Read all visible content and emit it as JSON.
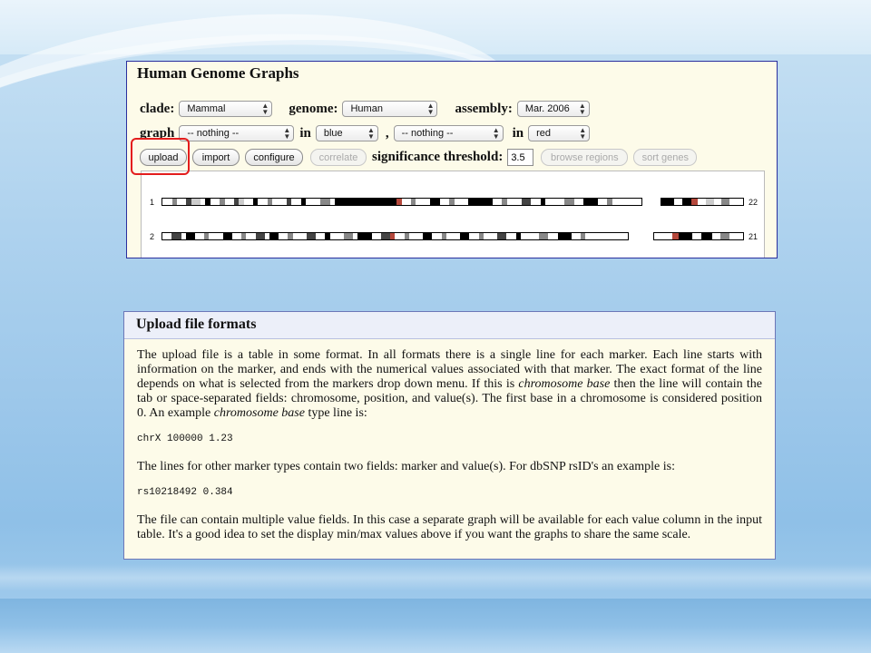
{
  "panel1": {
    "title": "Human Genome Graphs",
    "labels": {
      "clade": "clade:",
      "genome": "genome:",
      "assembly": "assembly:",
      "graph": "graph",
      "in1": "in",
      "comma": ",",
      "in2": "in",
      "significance": "significance threshold:"
    },
    "selects": {
      "clade": "Mammal",
      "genome": "Human",
      "assembly": "Mar. 2006",
      "graph1": "-- nothing --",
      "color1": "blue",
      "graph2": "-- nothing --",
      "color2": "red"
    },
    "buttons": {
      "upload": "upload",
      "import": "import",
      "configure": "configure",
      "correlate": "correlate",
      "browse_regions": "browse regions",
      "sort_genes": "sort genes"
    },
    "threshold_value": "3.5",
    "chromosomes": [
      {
        "left": "1",
        "right": "22"
      },
      {
        "left": "2",
        "right": "21"
      }
    ],
    "highlight_color": "#e31d1d"
  },
  "panel2": {
    "title": "Upload file formats",
    "p1_a": "The upload file is a table in some format. In all formats there is a single line for each marker. Each line starts with information on the marker, and ends with the numerical values associated with that marker. The exact format of the line depends on what is selected from the markers drop down menu. If this is ",
    "p1_em1": "chromosome base",
    "p1_b": " then the line will contain the tab or space-separated fields: chromosome, position, and value(s). The first base in a chromosome is considered position 0. An example ",
    "p1_em2": "chromosome base",
    "p1_c": " type line is:",
    "code1": "chrX 100000 1.23",
    "p2": "The lines for other marker types contain two fields: marker and value(s). For dbSNP rsID's an example is:",
    "code2": "rs10218492 0.384",
    "p3": "The file can contain multiple value fields. In this case a separate graph will be available for each value column in the input table. It's a good idea to set the display min/max values above if you want the graphs to share the same scale."
  }
}
